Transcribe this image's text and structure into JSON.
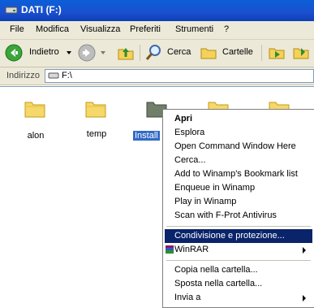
{
  "window": {
    "title": "DATI (F:)"
  },
  "menubar": {
    "items": [
      "File",
      "Modifica",
      "Visualizza",
      "Preferiti",
      "Strumenti",
      "?"
    ]
  },
  "toolbar": {
    "back_label": "Indietro",
    "search_label": "Cerca",
    "folders_label": "Cartelle"
  },
  "address": {
    "label": "Indirizzo",
    "value": "F:\\"
  },
  "files": [
    {
      "name": "alon",
      "selected": false
    },
    {
      "name": "temp",
      "selected": false
    },
    {
      "name": "Install",
      "selected": true
    }
  ],
  "context_menu": {
    "items": [
      {
        "label": "Apri",
        "bold": true
      },
      {
        "label": "Esplora"
      },
      {
        "label": "Open Command Window Here"
      },
      {
        "label": "Cerca..."
      },
      {
        "label": "Add to Winamp's Bookmark list"
      },
      {
        "label": "Enqueue in Winamp"
      },
      {
        "label": "Play in Winamp"
      },
      {
        "label": "Scan with F-Prot Antivirus"
      },
      {
        "label": "Condivisione e protezione...",
        "highlighted": true
      },
      {
        "label": "WinRAR",
        "submenu": true,
        "icon": "winrar-icon"
      },
      {
        "label": "Copia nella cartella..."
      },
      {
        "label": "Sposta nella cartella..."
      },
      {
        "label": "Invia a",
        "submenu": true
      }
    ]
  },
  "colors": {
    "titlebar": "#1b4fcf",
    "highlight": "#0a246a",
    "selection": "#316ac5"
  }
}
